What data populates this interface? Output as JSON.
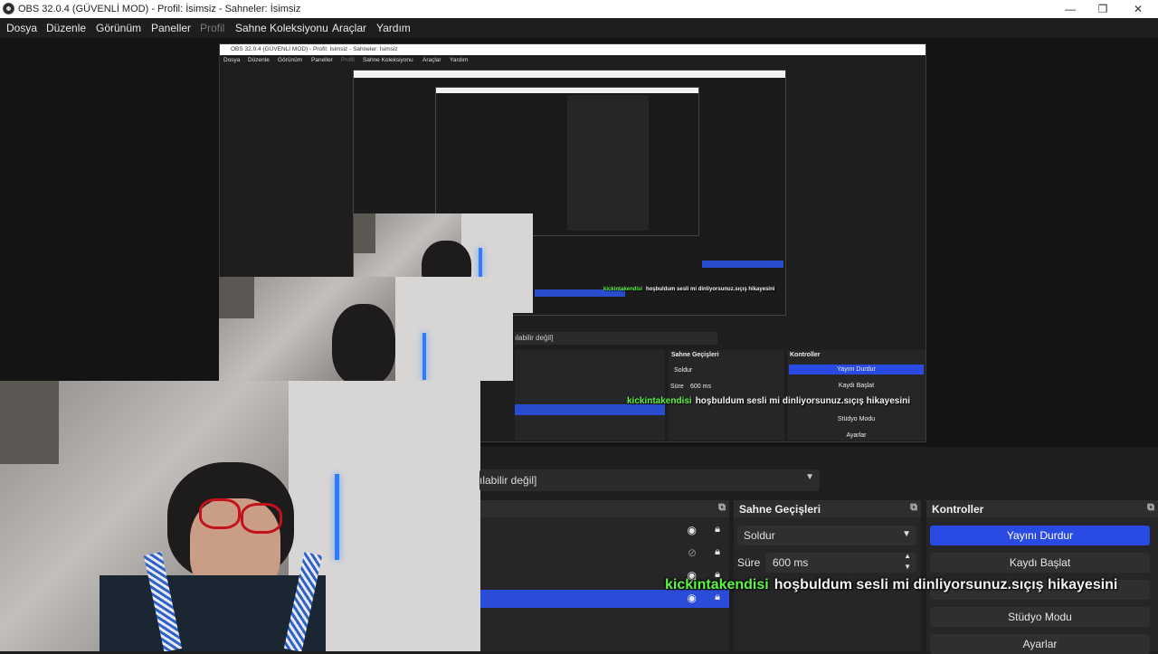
{
  "window": {
    "title": "OBS 32.0.4 (GÜVENLİ MOD) - Profil: İsimsiz - Sahneler: İsimsiz",
    "minimize": "—",
    "maximize": "❐",
    "close": "✕"
  },
  "menu": {
    "items": [
      "Dosya",
      "Düzenle",
      "Görünüm",
      "Paneller",
      "Profil",
      "Sahne Koleksiyonu",
      "Araçlar",
      "Yardım"
    ]
  },
  "inner": {
    "title": "OBS 32.0.4 (GÜVENLİ MOD) - Profil: İsimsiz - Sahneler: İsimsiz",
    "scene_text": "ılabilir değil]"
  },
  "scene_select": {
    "value": "ılabilir değil]"
  },
  "sources": {
    "icons": [
      "eye-icon",
      "lock-icon"
    ]
  },
  "transitions": {
    "title": "Sahne Geçişleri",
    "type": "Soldur",
    "duration_label": "Süre",
    "duration_value": "600 ms"
  },
  "controls": {
    "title": "Kontroller",
    "stop_stream": "Yayını Durdur",
    "start_record": "Kaydı Başlat",
    "studio_mode": "Stüdyo Modu",
    "settings": "Ayarlar"
  },
  "chat": {
    "user": "kickintakendisi",
    "message": "hoşbuldum sesli mi dinliyorsunuz.sıçış hikayesini"
  },
  "colors": {
    "accent": "#2a4be3",
    "chat_user": "#5cf542",
    "bg": "#1f1e1f"
  }
}
